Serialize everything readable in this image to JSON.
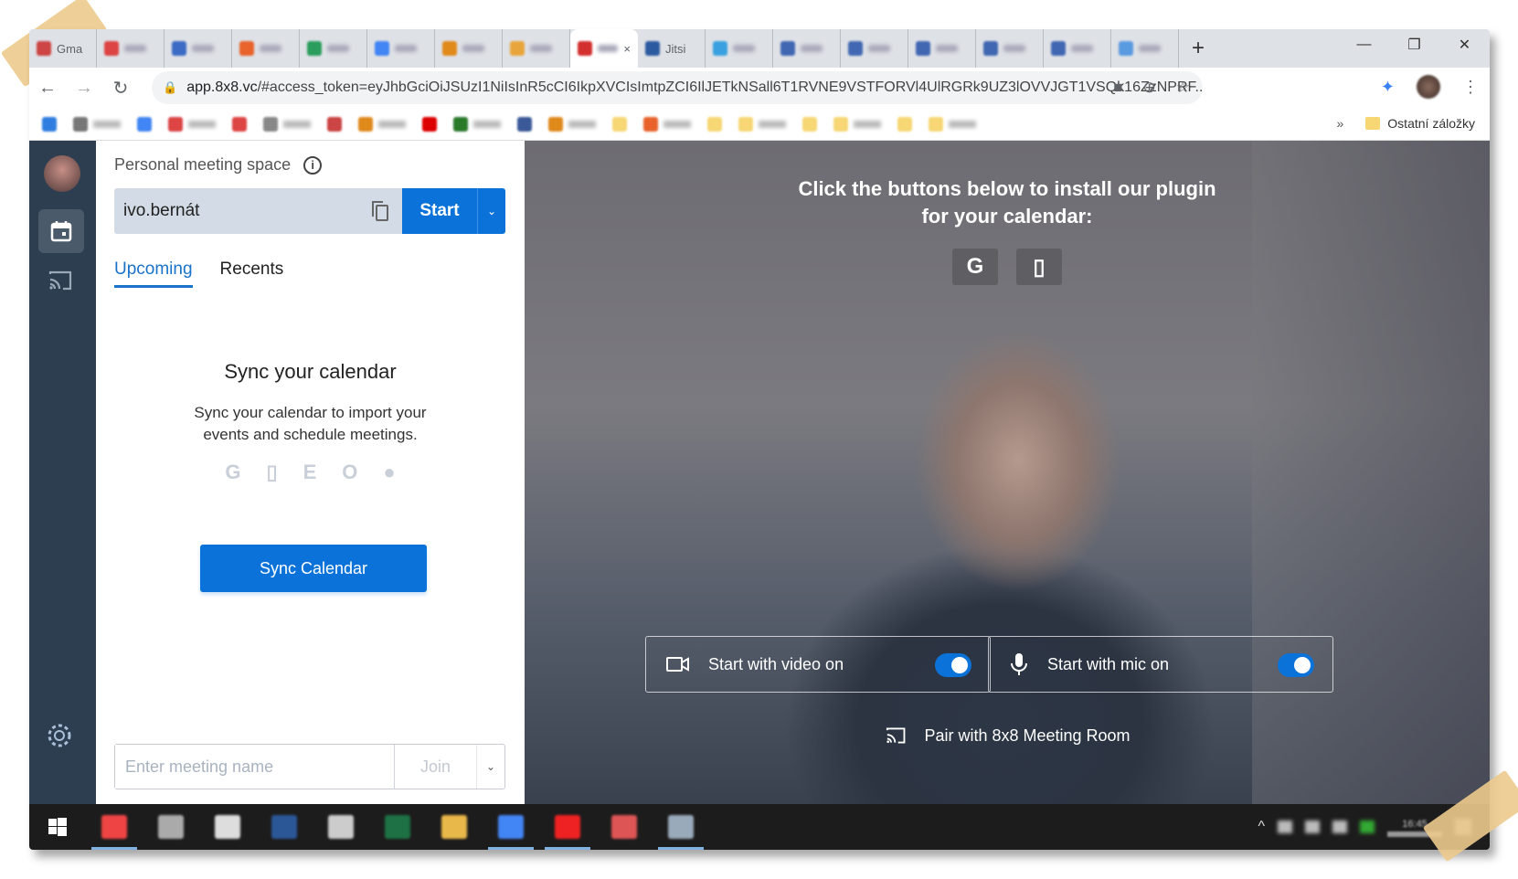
{
  "browser": {
    "tabs": [
      {
        "label": "Gma",
        "favicon": "#c44"
      },
      {
        "label": "",
        "favicon": "#d44"
      },
      {
        "label": "",
        "favicon": "#3b6bc4"
      },
      {
        "label": "",
        "favicon": "#e8622c"
      },
      {
        "label": "",
        "favicon": "#2a9d5c"
      },
      {
        "label": "",
        "favicon": "#4285f4"
      },
      {
        "label": "",
        "favicon": "#e08a1c"
      },
      {
        "label": "",
        "favicon": "#e8a53b"
      },
      {
        "label": "",
        "favicon": "#d32f2f",
        "active": true
      },
      {
        "label": "Jitsi",
        "favicon": "#2c5aa0"
      },
      {
        "label": "",
        "favicon": "#3aa0e0"
      },
      {
        "label": "",
        "favicon": "#4267b2"
      },
      {
        "label": "",
        "favicon": "#4267b2"
      },
      {
        "label": "",
        "favicon": "#4267b2"
      },
      {
        "label": "",
        "favicon": "#4267b2"
      },
      {
        "label": "",
        "favicon": "#4267b2"
      },
      {
        "label": "",
        "favicon": "#5a9ae0"
      }
    ],
    "url_host": "app.8x8.vc",
    "url_rest": "/#access_token=eyJhbGciOiJSUzI1NiIsInR5cCI6IkpXVCIsImtpZCI6IlJETkNSall6T1RVNE9VSTFORVl4UlRGRk9UZ3lOVVJGT1VSQk16ZzNPRF...",
    "bookmarks": [
      "#2f7de0",
      "#777",
      "#4285f4",
      "#d44",
      "#d44",
      "#888",
      "#c44",
      "#e08a1c",
      "#d00",
      "#2a7a2a",
      "#3b5998",
      "#e08a1c",
      "#f7d774",
      "#e8622c",
      "#f7d774",
      "#f7d774",
      "#f7d774",
      "#f7d774",
      "#f7d774",
      "#f7d774"
    ],
    "bookmarks_overflow": "»",
    "other_bookmarks": "Ostatní záložky"
  },
  "panel": {
    "pms_label": "Personal meeting space",
    "pms_value": "ivo.bernát",
    "start": "Start",
    "tabs": [
      "Upcoming",
      "Recents"
    ],
    "sync_title": "Sync your calendar",
    "sync_desc_1": "Sync your calendar to import your",
    "sync_desc_2": "events and schedule meetings.",
    "sync_button": "Sync Calendar",
    "meeting_placeholder": "Enter meeting name",
    "join": "Join"
  },
  "video": {
    "plugin_line1": "Click the buttons below to install our plugin",
    "plugin_line2": "for your calendar:",
    "video_toggle": "Start with video on",
    "video_on": true,
    "mic_toggle": "Start with mic on",
    "mic_on": true,
    "pair": "Pair with 8x8 Meeting Room"
  },
  "colors": {
    "accent": "#0a72d8",
    "rail": "#2c3e50"
  },
  "taskbar": {
    "apps": [
      "#e44",
      "#aaa",
      "#ddd",
      "#2b5797",
      "#ccc",
      "#1e7145",
      "#e8b84a",
      "#4285f4",
      "#e22",
      "#d55",
      "#9ab"
    ],
    "clock": "16:45"
  }
}
